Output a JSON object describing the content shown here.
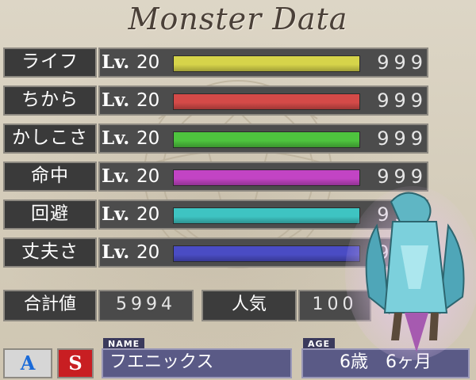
{
  "title": "Monster Data",
  "stats": [
    {
      "label": "ライフ",
      "lv_word": "Lv.",
      "lv_num": "20",
      "value": "999",
      "fill": 1.0,
      "color": "#d6d44a"
    },
    {
      "label": "ちから",
      "lv_word": "Lv.",
      "lv_num": "20",
      "value": "999",
      "fill": 1.0,
      "color": "#d44a48"
    },
    {
      "label": "かしこさ",
      "lv_word": "Lv.",
      "lv_num": "20",
      "value": "999",
      "fill": 1.0,
      "color": "#4ec43e"
    },
    {
      "label": "命中",
      "lv_word": "Lv.",
      "lv_num": "20",
      "value": "999",
      "fill": 1.0,
      "color": "#c244c4"
    },
    {
      "label": "回避",
      "lv_word": "Lv.",
      "lv_num": "20",
      "value": "999",
      "fill": 1.0,
      "color": "#3ec4c2"
    },
    {
      "label": "丈夫さ",
      "lv_word": "Lv.",
      "lv_num": "20",
      "value": "999",
      "fill": 1.0,
      "color": "#4a4cc4"
    }
  ],
  "totals": {
    "total_label": "合計値",
    "total_value": "5994",
    "popularity_label": "人気",
    "popularity_value": "100"
  },
  "buttons": {
    "a_label": "A",
    "s_label": "S"
  },
  "profile": {
    "name_tag": "NAME",
    "name": "フエニックス",
    "age_tag": "AGE",
    "age": "6歳　6ヶ月"
  },
  "icons": {
    "monster_sprite": "phoenix-monster-icon"
  }
}
